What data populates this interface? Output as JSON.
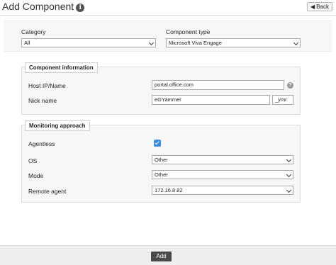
{
  "header": {
    "title": "Add Component",
    "info_icon": "info-icon",
    "back_label": "Back",
    "back_icon": "arrow-left-icon"
  },
  "top_panel": {
    "category_label": "Category",
    "category_value": "All",
    "component_type_label": "Component type",
    "component_type_value": "Microsoft Viva Engage"
  },
  "component_information": {
    "legend": "Component information",
    "host_label": "Host IP/Name",
    "host_value": "portal.office.com",
    "help_icon": "question-icon",
    "nick_label": "Nick name",
    "nick_value": "eGYammer",
    "nick_suffix": "_ymr"
  },
  "monitoring_approach": {
    "legend": "Monitoring approach",
    "agentless_label": "Agentless",
    "agentless_checked": true,
    "os_label": "OS",
    "os_value": "Other",
    "mode_label": "Mode",
    "mode_value": "Other",
    "remote_agent_label": "Remote agent",
    "remote_agent_value": "172.16.8.82"
  },
  "footer": {
    "add_label": "Add"
  },
  "colors": {
    "checkbox_accent": "#3c8dde",
    "add_button_bg": "#4a4a4a",
    "panel_bg": "#f7f7f7"
  }
}
